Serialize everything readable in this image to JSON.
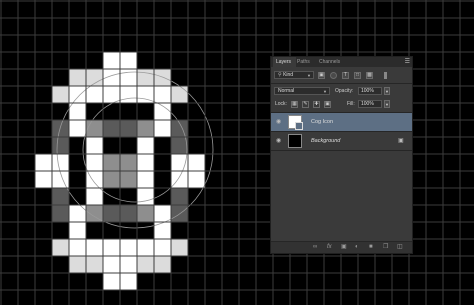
{
  "canvas": {
    "background": "#000000",
    "grid_color": "#3c3c3c"
  },
  "layers_panel": {
    "tabs": [
      {
        "label": "Layers",
        "active": true
      },
      {
        "label": "Paths",
        "active": false
      },
      {
        "label": "Channels",
        "active": false
      }
    ],
    "menu_icon": "panel-menu-icon",
    "filter": {
      "label": "Kind",
      "icons": [
        "image-filter-icon",
        "adjustment-filter-icon",
        "type-filter-icon",
        "shape-filter-icon",
        "smart-object-filter-icon"
      ]
    },
    "blend_mode": "Normal",
    "opacity_label": "Opacity:",
    "opacity_value": "100%",
    "lock_label": "Lock:",
    "lock_icons": [
      "lock-transparent-icon",
      "lock-image-icon",
      "lock-position-icon",
      "lock-all-icon"
    ],
    "fill_label": "Fill:",
    "fill_value": "100%",
    "layers": [
      {
        "name": "Cog Icon",
        "selected": true,
        "italic": false,
        "visible": true
      },
      {
        "name": "Background",
        "selected": false,
        "italic": true,
        "visible": true,
        "locked": true
      }
    ],
    "bottom_icons": [
      "link-layers-icon",
      "fx-icon",
      "layer-mask-icon",
      "adjustment-layer-icon",
      "group-icon",
      "new-layer-icon",
      "trash-icon"
    ],
    "colors": {
      "selected_row": "#5d6f84",
      "panel_bg": "#3a3a3a"
    }
  }
}
